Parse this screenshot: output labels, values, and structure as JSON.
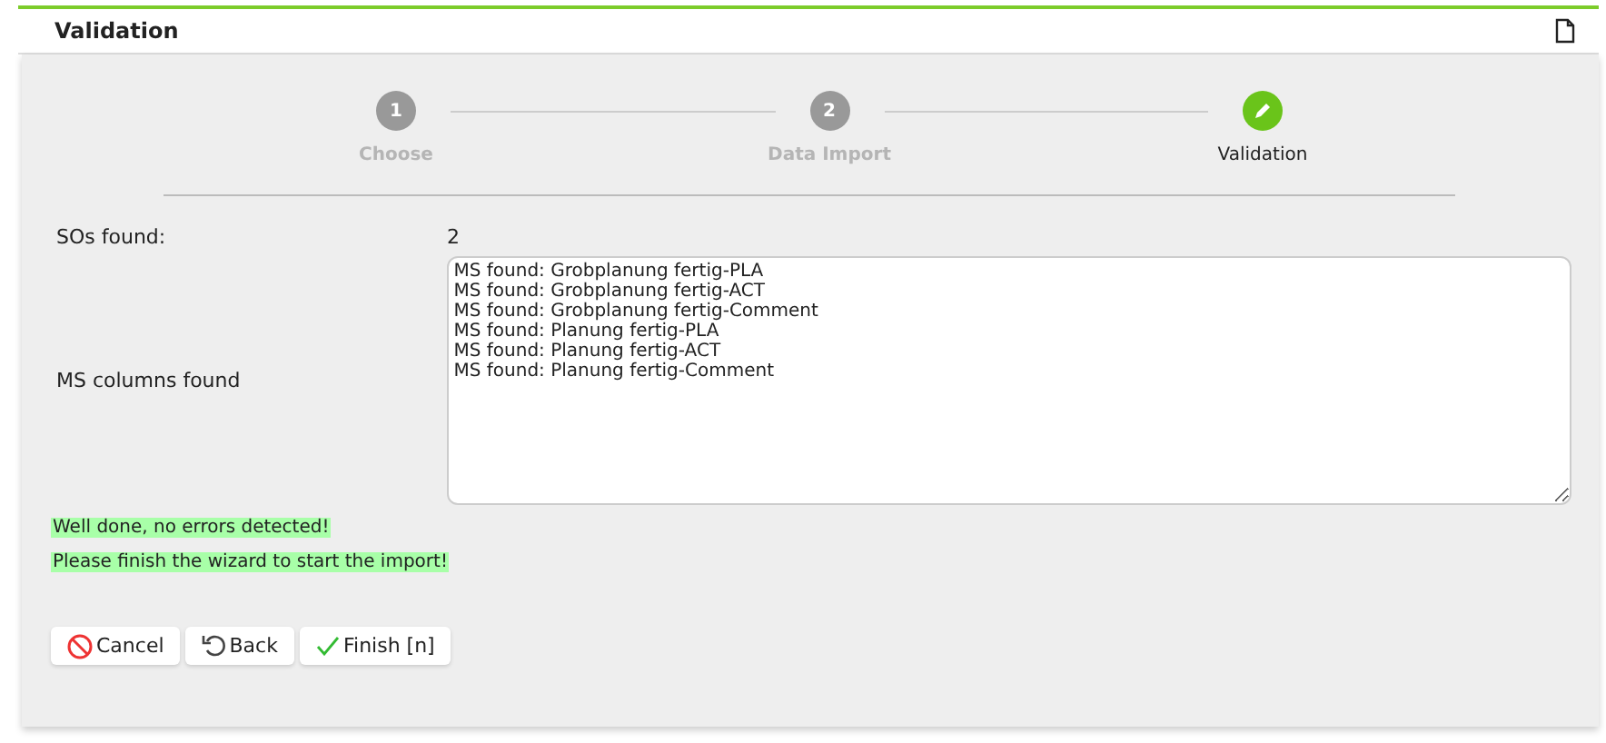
{
  "header": {
    "title": "Validation"
  },
  "steps": [
    {
      "kind": "number",
      "number": "1",
      "label": "Choose",
      "selected": false
    },
    {
      "kind": "number",
      "number": "2",
      "label": "Data Import",
      "selected": false
    },
    {
      "kind": "done",
      "label": "Validation",
      "selected": true
    }
  ],
  "fields": [
    {
      "kind": "value",
      "label": "SOs found:",
      "value": "2"
    },
    {
      "kind": "textarea",
      "label": "MS columns found",
      "lines": [
        "MS found: Grobplanung fertig-PLA",
        "MS found: Grobplanung fertig-ACT",
        "MS found: Grobplanung fertig-Comment",
        "MS found: Planung fertig-PLA",
        "MS found: Planung fertig-ACT",
        "MS found: Planung fertig-Comment"
      ]
    }
  ],
  "messages": [
    "Well done, no errors detected!",
    "Please finish the wizard to start the import!"
  ],
  "buttons": [
    {
      "kind": "cancel",
      "label": "Cancel"
    },
    {
      "kind": "back",
      "label": "Back"
    },
    {
      "kind": "finish",
      "label": "Finish [n]"
    }
  ]
}
